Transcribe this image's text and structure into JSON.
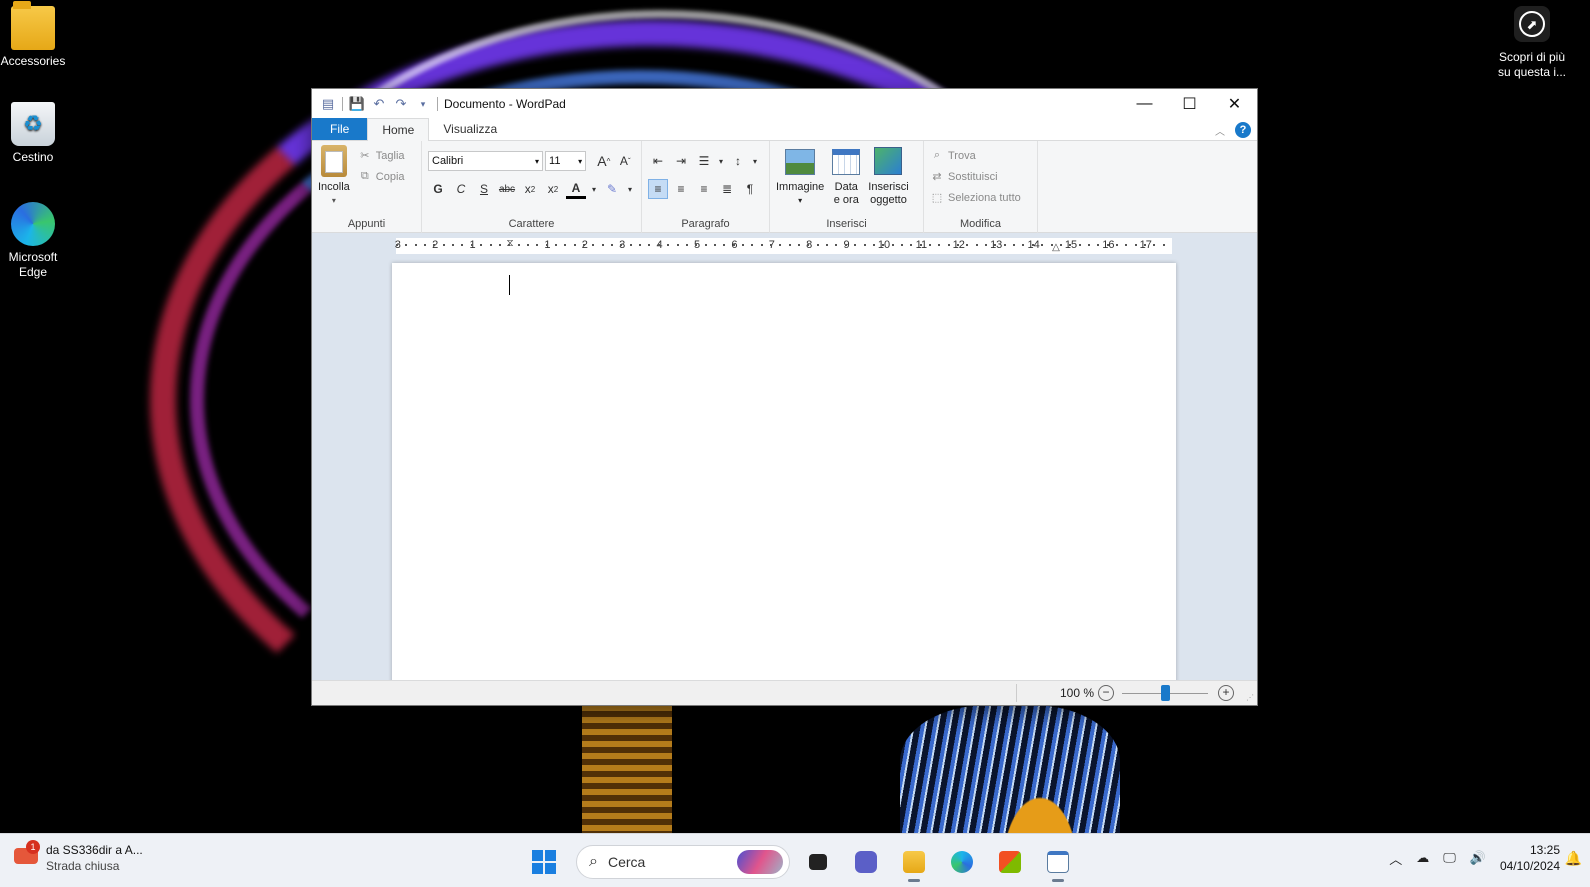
{
  "desktop": {
    "icons": [
      {
        "label": "Accessories"
      },
      {
        "label": "Cestino"
      },
      {
        "label": "Microsoft Edge"
      }
    ],
    "discover_line1": "Scopri di più",
    "discover_line2": "su questa i..."
  },
  "window": {
    "title": "Documento - WordPad",
    "tabs": {
      "file": "File",
      "home": "Home",
      "view": "Visualizza"
    },
    "clipboard": {
      "paste": "Incolla",
      "cut": "Taglia",
      "copy": "Copia",
      "label": "Appunti"
    },
    "font": {
      "family": "Calibri",
      "size": "11",
      "label": "Carattere",
      "bold": "G",
      "italic": "C",
      "underline": "S",
      "strike": "abc"
    },
    "paragraph": {
      "label": "Paragrafo"
    },
    "insert": {
      "image": "Immagine",
      "datetime_1": "Data",
      "datetime_2": "e ora",
      "object_1": "Inserisci",
      "object_2": "oggetto",
      "label": "Inserisci"
    },
    "edit": {
      "find": "Trova",
      "replace": "Sostituisci",
      "select_all": "Seleziona tutto",
      "label": "Modifica"
    },
    "ruler_numbers": [
      "3",
      "2",
      "1",
      "1",
      "2",
      "3",
      "4",
      "5",
      "6",
      "7",
      "8",
      "9",
      "10",
      "11",
      "12",
      "13",
      "14",
      "15",
      "16",
      "17"
    ],
    "zoom": "100 %"
  },
  "taskbar": {
    "news_title": "da SS336dir a A...",
    "news_sub": "Strada chiusa",
    "news_badge": "1",
    "search_placeholder": "Cerca",
    "time": "13:25",
    "date": "04/10/2024"
  },
  "colors": {
    "accent": "#1979ca",
    "ribbon_bg": "#f5f6f7",
    "doc_bg": "#dce4ee"
  }
}
